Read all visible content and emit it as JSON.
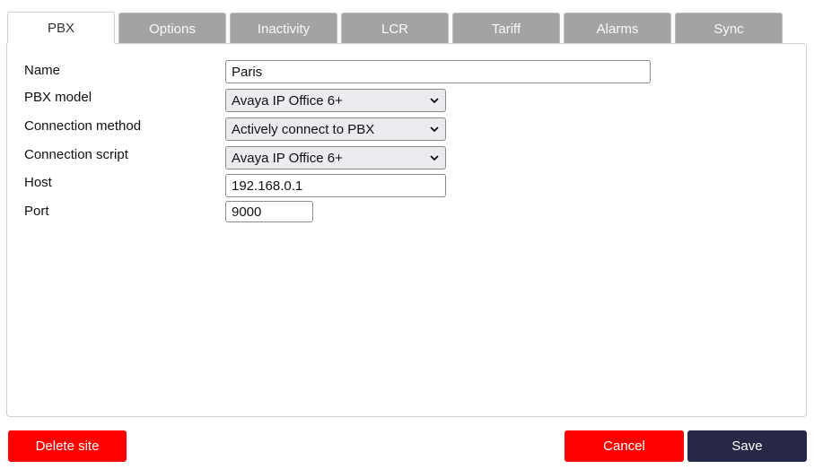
{
  "tabs": [
    {
      "label": "PBX",
      "active": true
    },
    {
      "label": "Options"
    },
    {
      "label": "Inactivity"
    },
    {
      "label": "LCR"
    },
    {
      "label": "Tariff"
    },
    {
      "label": "Alarms"
    },
    {
      "label": "Sync"
    }
  ],
  "form": {
    "name": {
      "label": "Name",
      "value": "Paris"
    },
    "pbx_model": {
      "label": "PBX model",
      "value": "Avaya IP Office 6+"
    },
    "connection_method": {
      "label": "Connection method",
      "value": "Actively connect to PBX"
    },
    "connection_script": {
      "label": "Connection script",
      "value": "Avaya IP Office 6+"
    },
    "host": {
      "label": "Host",
      "value": "192.168.0.1"
    },
    "port": {
      "label": "Port",
      "value": "9000"
    }
  },
  "buttons": {
    "delete": "Delete site",
    "cancel": "Cancel",
    "save": "Save"
  },
  "colors": {
    "danger": "#ff0000",
    "primary": "#262845",
    "tab_inactive": "#a3a3a3"
  }
}
